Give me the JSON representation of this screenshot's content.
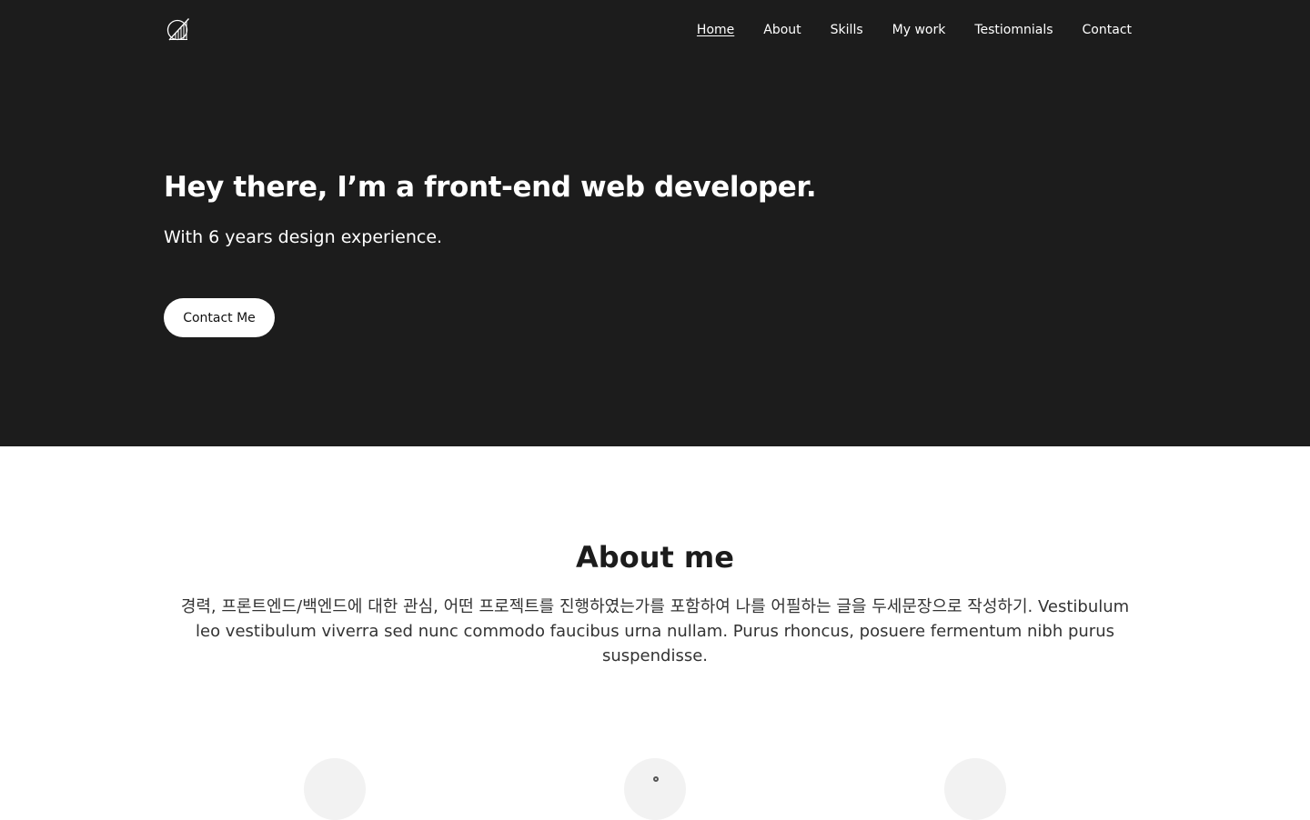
{
  "header": {
    "logo_icon": "logo-circle-slash-icon",
    "nav": [
      {
        "label": "Home",
        "active": true
      },
      {
        "label": "About",
        "active": false
      },
      {
        "label": "Skills",
        "active": false
      },
      {
        "label": "My work",
        "active": false
      },
      {
        "label": "Testiomnials",
        "active": false
      },
      {
        "label": "Contact",
        "active": false
      }
    ]
  },
  "hero": {
    "title": "Hey there, I’m a front-end web developer.",
    "subtitle": "With 6 years design experience.",
    "cta_label": "Contact Me"
  },
  "about": {
    "title": "About me",
    "text": "경력, 프론트엔드/백엔드에 대한 관심, 어떤 프로젝트를 진행하였는가를 포함하여 나를 어필하는 글을 두세문장으로 작성하기. Vestibulum leo vestibulum viverra sed nunc commodo faucibus urna nullam. Purus rhoncus, posuere fermentum nibh purus suspendisse."
  },
  "colors": {
    "hero_background": "#1c1c1c",
    "page_background": "#ffffff",
    "button_background": "#ffffff",
    "skill_circle": "#f2f2f2"
  }
}
